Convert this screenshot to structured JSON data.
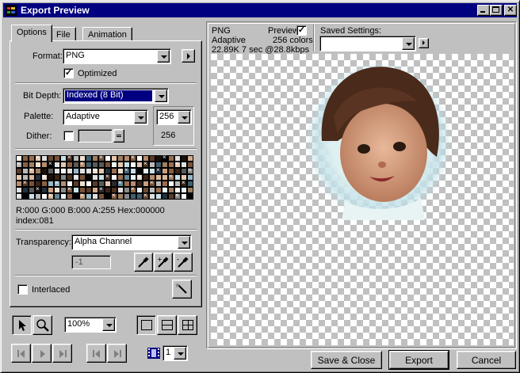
{
  "window": {
    "title": "Export Preview"
  },
  "tabs": [
    {
      "label": "Options"
    },
    {
      "label": "File"
    },
    {
      "label": "Animation"
    }
  ],
  "options": {
    "format_label": "Format:",
    "format_value": "PNG",
    "optimized_label": "Optimized",
    "optimized_checked": true,
    "bit_depth_label": "Bit Depth:",
    "bit_depth_value": "Indexed (8 Bit)",
    "palette_label": "Palette:",
    "palette_value": "Adaptive",
    "colors_value": "256",
    "colors_count": "256",
    "dither_label": "Dither:",
    "color_info": "R:000 G:000 B:000 A:255 Hex:000000",
    "index_info": "index:081",
    "transparency_label": "Transparency:",
    "transparency_value": "Alpha Channel",
    "alpha_value": "-1",
    "interlaced_label": "Interlaced"
  },
  "bottom_tools": {
    "zoom_value": "100%",
    "frame_value": "1"
  },
  "preview": {
    "format": "PNG",
    "preview_label": "Preview",
    "palette": "Adaptive",
    "colors": "256 colors",
    "size_info": "22.89K  7 sec @28.8kbps",
    "saved_settings_label": "Saved Settings:"
  },
  "buttons": {
    "save_close": "Save & Close",
    "export": "Export",
    "cancel": "Cancel"
  },
  "colors": {
    "titlebar": "#000080",
    "face": "#c0c0c0",
    "selection": "#000080"
  }
}
